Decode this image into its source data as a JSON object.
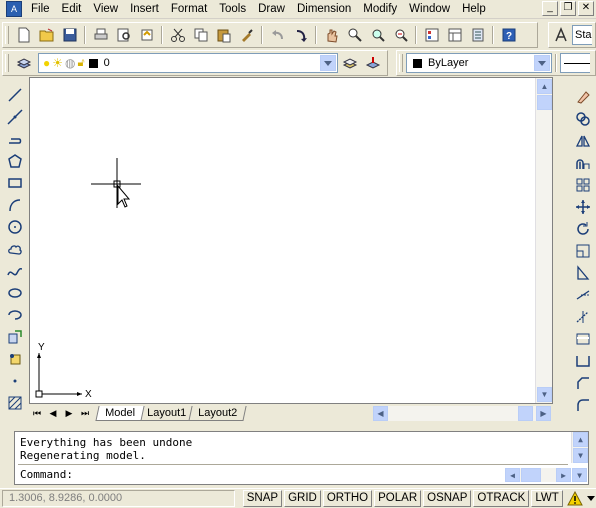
{
  "app": {
    "icon_label": "A"
  },
  "menu": [
    "File",
    "Edit",
    "View",
    "Insert",
    "Format",
    "Tools",
    "Draw",
    "Dimension",
    "Modify",
    "Window",
    "Help"
  ],
  "window_controls": {
    "minimize": "_",
    "restore": "❐",
    "close": "✕"
  },
  "standard_toolbar": {
    "icons": [
      "new-icon",
      "open-icon",
      "save-icon",
      "plot-icon",
      "plot-preview-icon",
      "publish-icon",
      "cut-icon",
      "copy-icon",
      "paste-icon",
      "match-properties-icon",
      "undo-icon",
      "redo-icon",
      "pan-icon",
      "zoom-realtime-icon",
      "zoom-window-icon",
      "zoom-previous-icon",
      "properties-icon",
      "design-center-icon",
      "tool-palettes-icon",
      "help-icon",
      "text-style-icon"
    ],
    "text_style_partial": "Sta"
  },
  "layers_toolbar": {
    "layer_name": "0",
    "color_value": "ByLayer"
  },
  "draw_toolbar": [
    "line-icon",
    "construction-line-icon",
    "polyline-icon",
    "polygon-icon",
    "rectangle-icon",
    "arc-icon",
    "circle-icon",
    "revision-cloud-icon",
    "spline-icon",
    "ellipse-icon",
    "ellipse-arc-icon",
    "insert-block-icon",
    "make-block-icon",
    "point-icon",
    "hatch-icon"
  ],
  "modify_toolbar": [
    "erase-icon",
    "copy-object-icon",
    "mirror-icon",
    "offset-icon",
    "array-icon",
    "move-icon",
    "rotate-icon",
    "scale-icon",
    "stretch-icon",
    "trim-icon",
    "extend-icon",
    "break-icon",
    "join-icon",
    "chamfer-icon",
    "fillet-icon"
  ],
  "ucs": {
    "x_label": "X",
    "y_label": "Y"
  },
  "tabs": [
    {
      "label": "Model",
      "active": true
    },
    {
      "label": "Layout1",
      "active": false
    },
    {
      "label": "Layout2",
      "active": false
    }
  ],
  "command_window": {
    "lines": [
      "Everything has been undone",
      "Regenerating model."
    ],
    "prompt": "Command:"
  },
  "status": {
    "coordinates": "1.3006, 8.9286, 0.0000",
    "buttons": [
      "SNAP",
      "GRID",
      "ORTHO",
      "POLAR",
      "OSNAP",
      "OTRACK",
      "LWT"
    ]
  }
}
